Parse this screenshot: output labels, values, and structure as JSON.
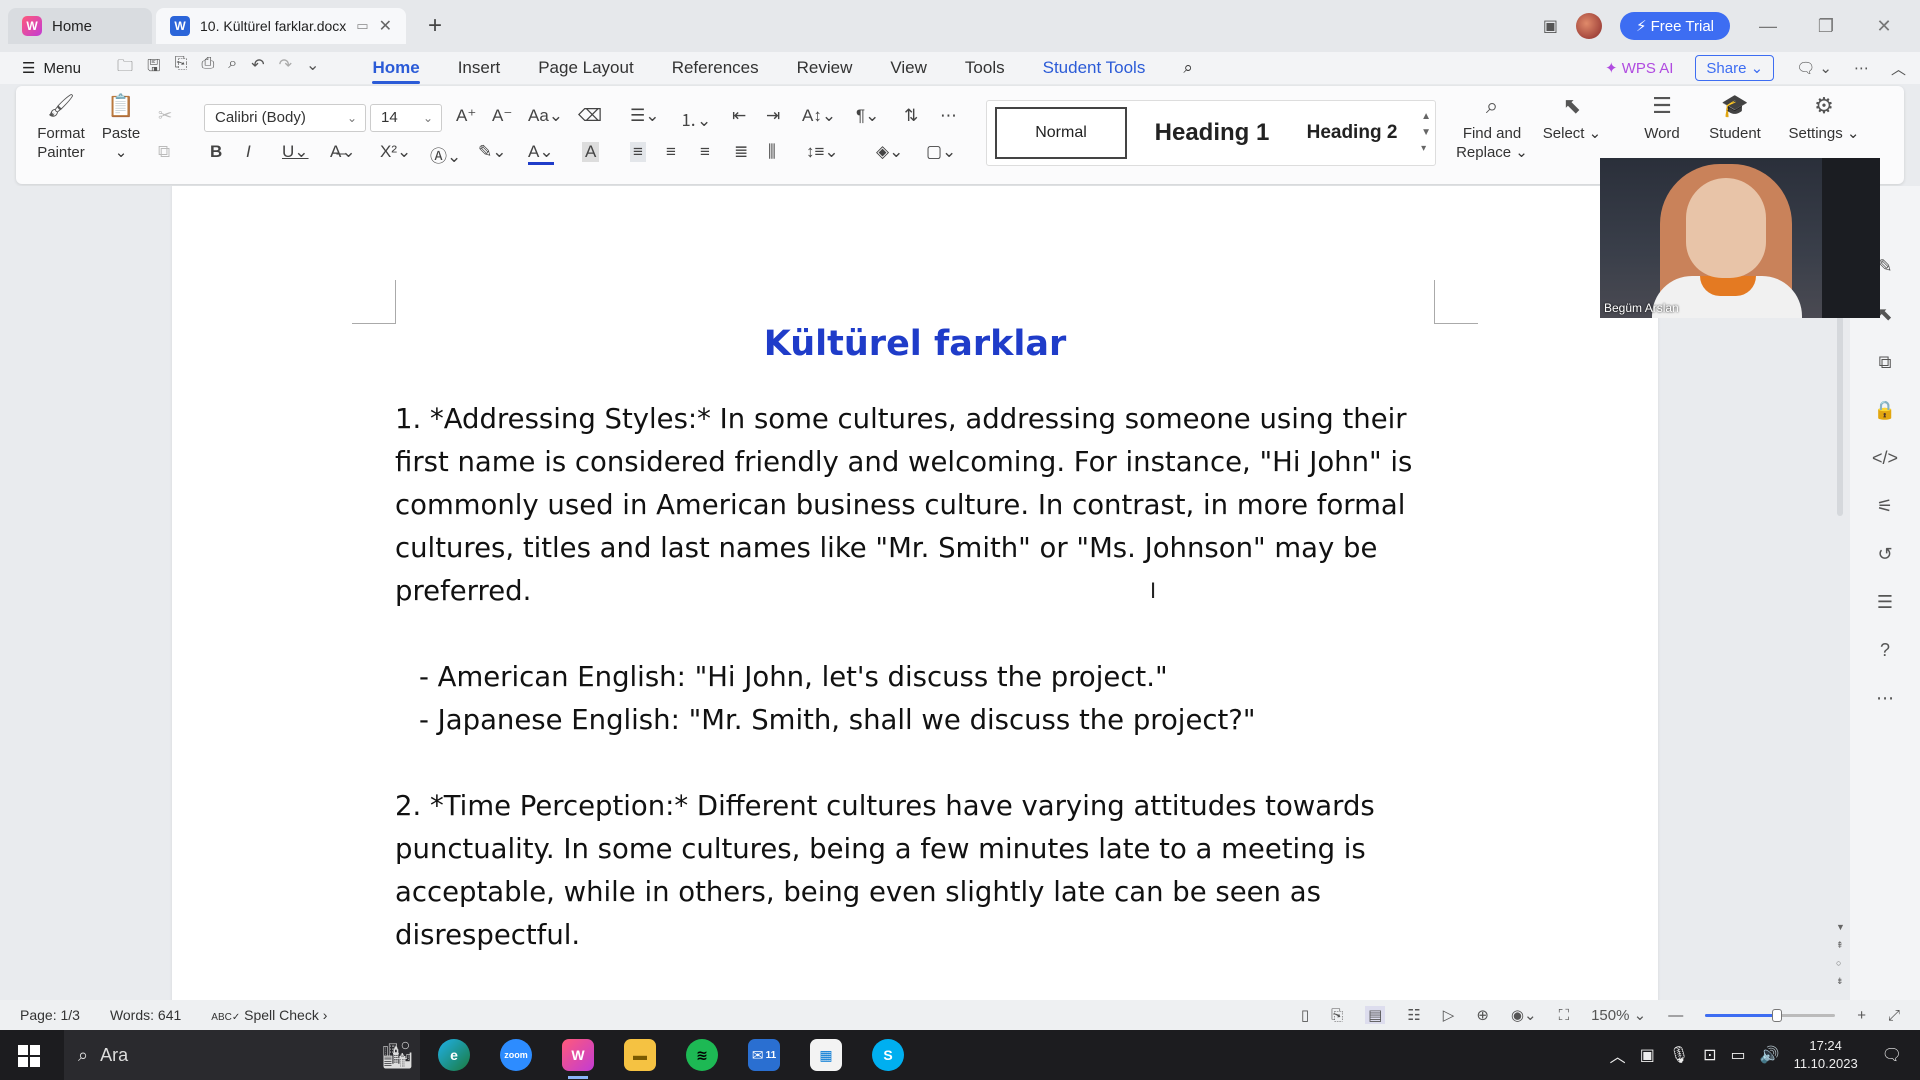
{
  "titlebar": {
    "home_tab": "Home",
    "doc_tab": "10. Kültürel farklar.docx",
    "free_trial": "Free Trial"
  },
  "menubar": {
    "menu_label": "Menu",
    "tabs": [
      "Home",
      "Insert",
      "Page Layout",
      "References",
      "Review",
      "View",
      "Tools",
      "Student Tools"
    ],
    "wps_ai": "WPS AI",
    "share": "Share"
  },
  "ribbon": {
    "format_painter": "Format Painter",
    "paste": "Paste",
    "font_name": "Calibri (Body)",
    "font_size": "14",
    "style_normal": "Normal",
    "style_h1": "Heading 1",
    "style_h2": "Heading 2",
    "find_replace": "Find and Replace",
    "select": "Select",
    "word": "Word",
    "student": "Student",
    "settings": "Settings"
  },
  "document": {
    "title": "Kültürel farklar",
    "para1": "1. *Addressing Styles:* In some cultures, addressing someone using their first name is considered friendly and welcoming. For instance, \"Hi John\" is commonly used in American business culture. In contrast, in more formal cultures, titles and last names like \"Mr. Smith\" or \"Ms. Johnson\" may be preferred.",
    "bullet1": "- American English: \"Hi John, let's discuss the project.\"",
    "bullet2": "- Japanese English: \"Mr. Smith, shall we discuss the project?\"",
    "para2": "2. *Time Perception:* Different cultures have varying attitudes towards punctuality. In some cultures, being a few minutes late to a meeting is acceptable, while in others, being even slightly late can be seen as disrespectful."
  },
  "webcam": {
    "name": "Begüm Arslan"
  },
  "statusbar": {
    "page": "Page: 1/3",
    "words": "Words: 641",
    "spell_check": "Spell Check",
    "zoom": "150%",
    "zoom_level_fraction": 0.55
  },
  "taskbar": {
    "search_placeholder": "Ara",
    "mail_badge": "11",
    "time": "17:24",
    "date": "11.10.2023"
  },
  "colors": {
    "accent": "#2b5bd7",
    "title_blue": "#1f3cc9",
    "free_trial_bg": "#3d6df2"
  }
}
